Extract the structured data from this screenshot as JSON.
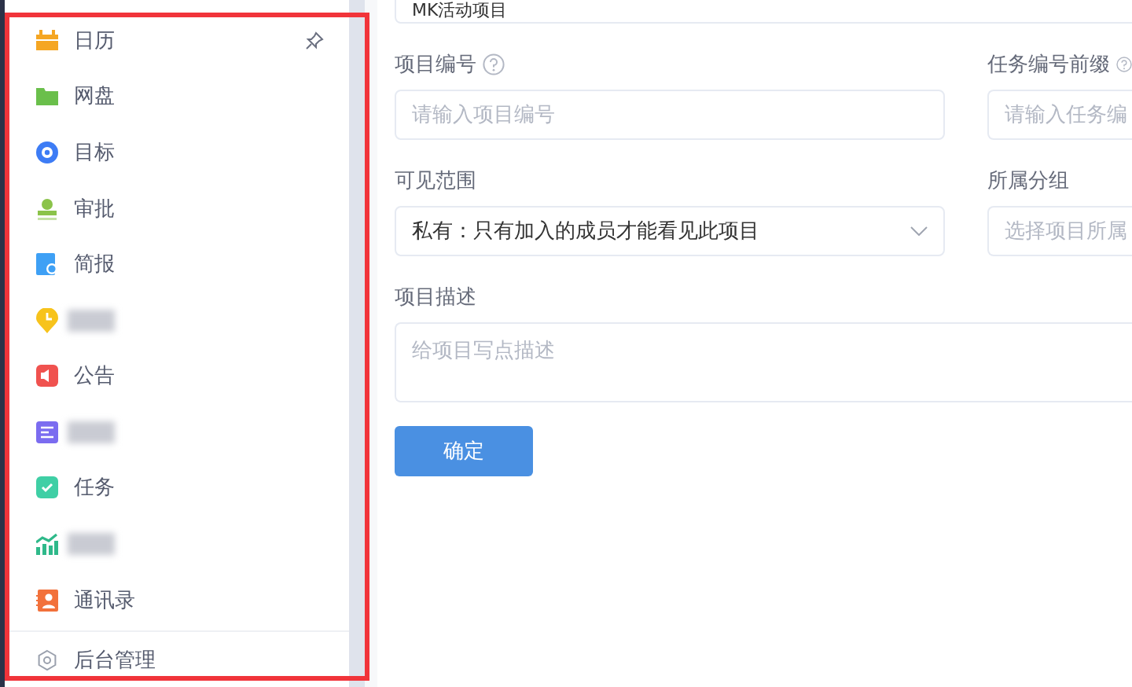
{
  "sidebar": {
    "items": [
      {
        "kind": "app",
        "label": "日历",
        "pinned": true
      },
      {
        "kind": "app",
        "label": "网盘",
        "pinned": false
      },
      {
        "kind": "app",
        "label": "目标",
        "pinned": false
      },
      {
        "kind": "app",
        "label": "审批",
        "pinned": false
      },
      {
        "kind": "app",
        "label": "简报",
        "pinned": false
      },
      {
        "kind": "blurred",
        "pinned": false
      },
      {
        "kind": "app",
        "label": "公告",
        "pinned": false
      },
      {
        "kind": "blurred",
        "pinned": false
      },
      {
        "kind": "app",
        "label": "任务",
        "pinned": false
      },
      {
        "kind": "blurred",
        "pinned": false
      },
      {
        "kind": "app",
        "label": "通讯录",
        "pinned": false
      }
    ],
    "footer": {
      "label": "后台管理"
    }
  },
  "form": {
    "name_field": {
      "value": "MK活动项目"
    },
    "rows": [
      [
        {
          "label": "项目编号",
          "help": true,
          "kind": "input",
          "placeholder": "请输入项目编号"
        },
        {
          "label": "任务编号前缀",
          "help": true,
          "kind": "input",
          "placeholder": "请输入任务编"
        }
      ],
      [
        {
          "label": "可见范围",
          "help": false,
          "kind": "select",
          "value": "私有：只有加入的成员才能看见此项目"
        },
        {
          "label": "所属分组",
          "help": false,
          "kind": "select",
          "placeholder": "选择项目所属"
        }
      ]
    ],
    "description": {
      "label": "项目描述",
      "placeholder": "给项目写点描述"
    },
    "submit": "确定"
  }
}
